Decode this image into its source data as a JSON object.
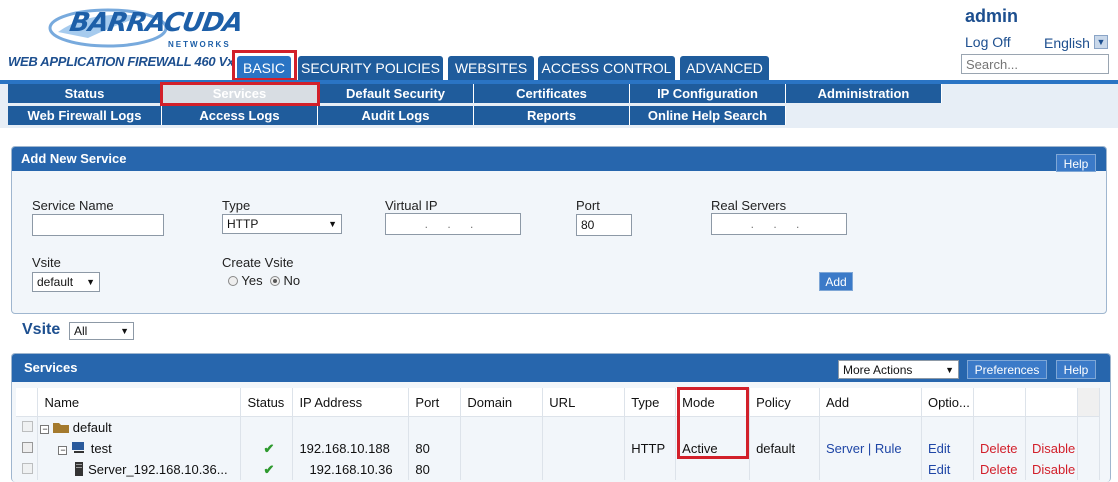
{
  "brand": {
    "name": "BARRACUDA",
    "sub": "NETWORKS",
    "product": "WEB APPLICATION FIREWALL 460 Vx"
  },
  "user": {
    "name": "admin",
    "logoff": "Log Off",
    "language": "English",
    "search_placeholder": "Search..."
  },
  "top_tabs": [
    "BASIC",
    "SECURITY POLICIES",
    "WEBSITES",
    "ACCESS CONTROL",
    "ADVANCED"
  ],
  "sub_tabs_row1": [
    "Status",
    "Services",
    "Default Security",
    "Certificates",
    "IP Configuration",
    "Administration"
  ],
  "sub_tabs_row2": [
    "Web Firewall Logs",
    "Access Logs",
    "Audit Logs",
    "Reports",
    "Online Help Search"
  ],
  "add_service": {
    "title": "Add New Service",
    "help": "Help",
    "service_name_label": "Service Name",
    "type_label": "Type",
    "type_value": "HTTP",
    "virtual_ip_label": "Virtual IP",
    "port_label": "Port",
    "port_value": "80",
    "real_servers_label": "Real Servers",
    "vsite_label": "Vsite",
    "vsite_value": "default",
    "create_vsite_label": "Create Vsite",
    "yes": "Yes",
    "no": "No",
    "add_button": "Add"
  },
  "vsite_filter": {
    "label": "Vsite",
    "value": "All"
  },
  "services": {
    "title": "Services",
    "more_actions": "More Actions",
    "preferences": "Preferences",
    "help": "Help",
    "columns": [
      "Name",
      "Status",
      "IP Address",
      "Port",
      "Domain",
      "URL",
      "Type",
      "Mode",
      "Policy",
      "Add",
      "Optio..."
    ],
    "rows": [
      {
        "name": "default",
        "status": "",
        "ip": "",
        "port": "",
        "domain": "",
        "url": "",
        "type": "",
        "mode": "",
        "policy": "",
        "add": "",
        "edit": "",
        "delete": "",
        "disable": ""
      },
      {
        "name": "test",
        "status": "✔",
        "ip": "192.168.10.188",
        "port": "80",
        "domain": "",
        "url": "",
        "type": "HTTP",
        "mode": "Active",
        "policy": "default",
        "add": "Server | Rule",
        "edit": "Edit",
        "delete": "Delete",
        "disable": "Disable"
      },
      {
        "name": "Server_192.168.10.36...",
        "status": "✔",
        "ip": "192.168.10.36",
        "port": "80",
        "domain": "",
        "url": "",
        "type": "",
        "mode": "",
        "policy": "",
        "add": "",
        "edit": "Edit",
        "delete": "Delete",
        "disable": "Disable"
      }
    ]
  },
  "colors": {
    "nav_blue": "#1f5c9c",
    "active_tab": "#2a74c4",
    "highlight_red": "#d2202a"
  }
}
